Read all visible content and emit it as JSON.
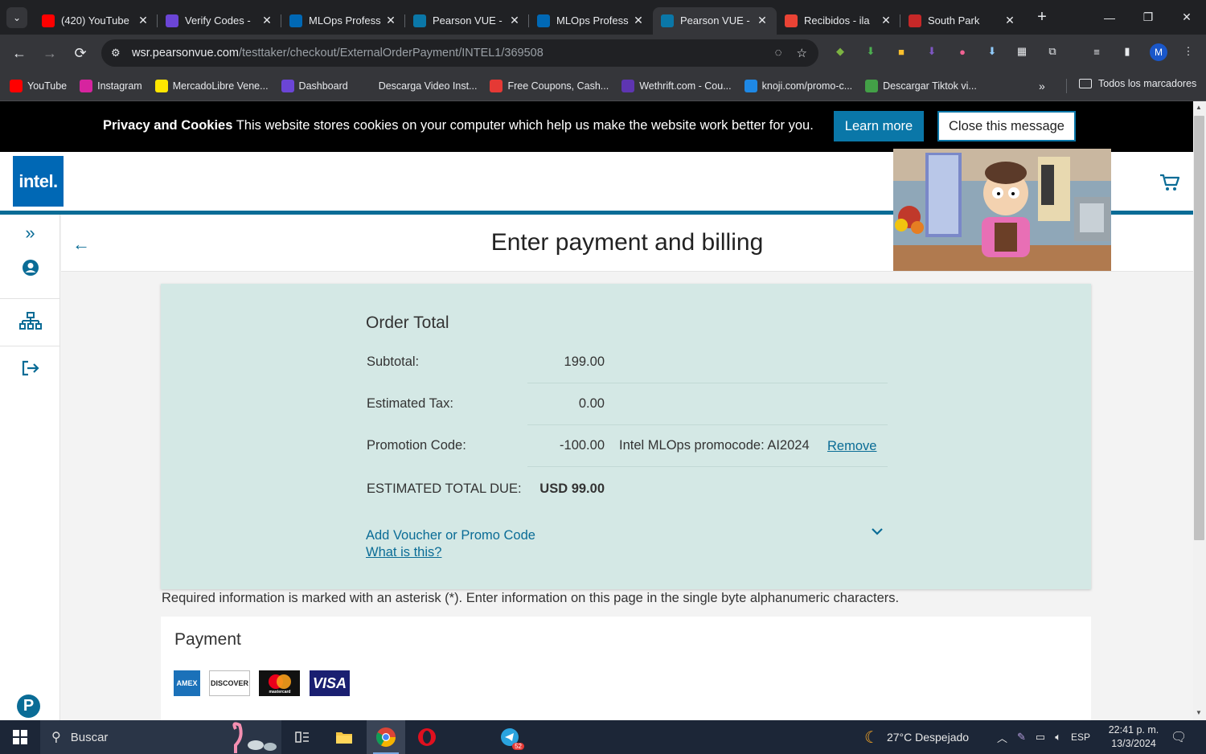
{
  "browser": {
    "tabs": [
      {
        "title": "(420) YouTube",
        "favicon": "youtube-icon",
        "color": "#ff0000",
        "active": false
      },
      {
        "title": "Verify Codes -",
        "favicon": "mail-icon",
        "color": "#6b45d6",
        "active": false
      },
      {
        "title": "MLOps Profess",
        "favicon": "intel-icon",
        "color": "#0068b5",
        "active": false
      },
      {
        "title": "Pearson VUE -",
        "favicon": "pearson-icon",
        "color": "#0a77a8",
        "active": false
      },
      {
        "title": "MLOps Profess",
        "favicon": "intel-icon",
        "color": "#0068b5",
        "active": false
      },
      {
        "title": "Pearson VUE -",
        "favicon": "pearson-icon",
        "color": "#0a77a8",
        "active": true
      },
      {
        "title": "Recibidos - ila",
        "favicon": "gmail-icon",
        "color": "#ea4335",
        "active": false
      },
      {
        "title": "South Park",
        "favicon": "southpark-icon",
        "color": "#c62828",
        "active": false
      }
    ],
    "url_host": "wsr.pearsonvue.com",
    "url_path": "/testtaker/checkout/ExternalOrderPayment/INTEL1/369508",
    "profile_initial": "M",
    "bookmarks": [
      {
        "label": "YouTube",
        "icon": "youtube-icon",
        "color": "#ff0000"
      },
      {
        "label": "Instagram",
        "icon": "instagram-icon",
        "color": "#d6249f"
      },
      {
        "label": "MercadoLibre Vene...",
        "icon": "mercadolibre-icon",
        "color": "#ffe600"
      },
      {
        "label": "Dashboard",
        "icon": "dashboard-icon",
        "color": "#6b45d6"
      },
      {
        "label": "Descarga Video Inst...",
        "icon": "download-icon",
        "color": "#35363a"
      },
      {
        "label": "Free Coupons, Cash...",
        "icon": "coupon-icon",
        "color": "#e53935"
      },
      {
        "label": "Wethrift.com - Cou...",
        "icon": "wethrift-icon",
        "color": "#5e35b1"
      },
      {
        "label": "knoji.com/promo-c...",
        "icon": "knoji-icon",
        "color": "#1e88e5"
      },
      {
        "label": "Descargar Tiktok vi...",
        "icon": "tiktok-download-icon",
        "color": "#43a047"
      }
    ],
    "all_bookmarks_label": "Todos los marcadores"
  },
  "cookie_banner": {
    "title": "Privacy and Cookies",
    "text": "This website stores cookies on your computer which help us make the website work better for you.",
    "learn_more": "Learn more",
    "close": "Close this message"
  },
  "header": {
    "logo": "intel."
  },
  "page": {
    "title": "Enter payment and billing"
  },
  "order": {
    "title": "Order Total",
    "subtotal_label": "Subtotal:",
    "subtotal_value": "199.00",
    "tax_label": "Estimated Tax:",
    "tax_value": "0.00",
    "promo_label": "Promotion Code:",
    "promo_value": "-100.00",
    "promo_note": "Intel MLOps promocode: AI2024",
    "remove_label": "Remove",
    "total_label": "ESTIMATED TOTAL DUE:",
    "total_value": "USD 99.00",
    "voucher_label": "Add Voucher or Promo Code",
    "what_is_this": "What is this?"
  },
  "required_note": "Required information is marked with an asterisk (*). Enter information on this page in the single byte alphanumeric characters.",
  "payment": {
    "title": "Payment",
    "cards": [
      "AMEX",
      "DISCOVER",
      "mastercard",
      "VISA"
    ]
  },
  "taskbar": {
    "search_placeholder": "Buscar",
    "weather": "27°C  Despejado",
    "language": "ESP",
    "time": "22:41 p. m.",
    "date": "13/3/2024",
    "telegram_badge": "52"
  }
}
